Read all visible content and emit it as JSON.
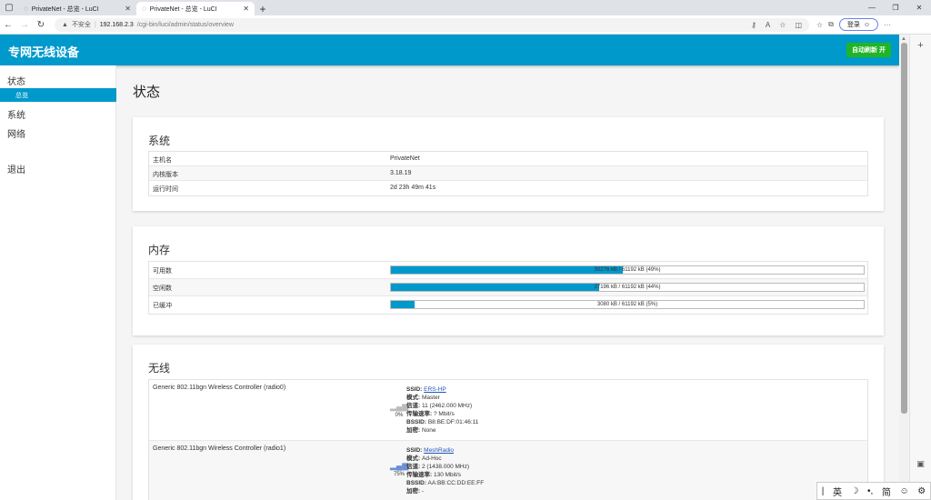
{
  "browser": {
    "tabs": [
      {
        "title": "PrivateNet - 总览 - LuCI",
        "active": false
      },
      {
        "title": "PrivateNet - 总览 - LuCI",
        "active": true
      }
    ],
    "insecure_label": "不安全",
    "url_host": "192.168.2.3",
    "url_path": "/cgi-bin/luci/admin/status/overview",
    "login_label": "登录"
  },
  "luci": {
    "brand": "专网无线设备",
    "auto_refresh": "自动刷新 开",
    "colors": {
      "header": "#0099cc",
      "refresh_badge": "#1fb525"
    }
  },
  "sidebar": {
    "items": [
      {
        "label": "状态"
      },
      {
        "label": "系统"
      },
      {
        "label": "网络"
      },
      {
        "label": "退出"
      }
    ],
    "active_sub": "总览"
  },
  "page_title": "状态",
  "system": {
    "title": "系统",
    "rows": [
      {
        "key": "主机名",
        "value": "PrivateNet"
      },
      {
        "key": "内核版本",
        "value": "3.18.19"
      },
      {
        "key": "运行时间",
        "value": "2d 23h 49m 41s"
      }
    ]
  },
  "memory": {
    "title": "内存",
    "rows": [
      {
        "key": "可用数",
        "text": "30276 kB / 61192 kB (49%)",
        "percent": 49
      },
      {
        "key": "空闲数",
        "text": "27196 kB / 61192 kB (44%)",
        "percent": 44
      },
      {
        "key": "已缓冲",
        "text": "3080 kB / 61192 kB (5%)",
        "percent": 5
      }
    ]
  },
  "wireless": {
    "title": "无线",
    "radios": [
      {
        "name": "Generic 802.11bgn Wireless Controller (radio0)",
        "signal": "0%",
        "ssid_label": "SSID:",
        "ssid": "ERS-HP",
        "mode_label": "模式:",
        "mode": "Master",
        "channel_label": "信道:",
        "channel": "11 (2462.000 MHz)",
        "rate_label": "传输速率:",
        "rate": "? Mbit/s",
        "bssid_label": "BSSID:",
        "bssid": "B8:BE:DF:01:46:11",
        "enc_label": "加密:",
        "enc": "None"
      },
      {
        "name": "Generic 802.11bgn Wireless Controller (radio1)",
        "signal": "75%",
        "ssid_label": "SSID:",
        "ssid": "MeshRadio",
        "mode_label": "模式:",
        "mode": "Ad-Hoc",
        "channel_label": "信道:",
        "channel": "2 (1438.000 MHz)",
        "rate_label": "传输速率:",
        "rate": "130 Mbit/s",
        "bssid_label": "BSSID:",
        "bssid": "AA:BB:CC:DD:EE:FF",
        "enc_label": "加密:",
        "enc": "-"
      }
    ]
  },
  "ime": {
    "lang": "英",
    "mode": "简"
  }
}
